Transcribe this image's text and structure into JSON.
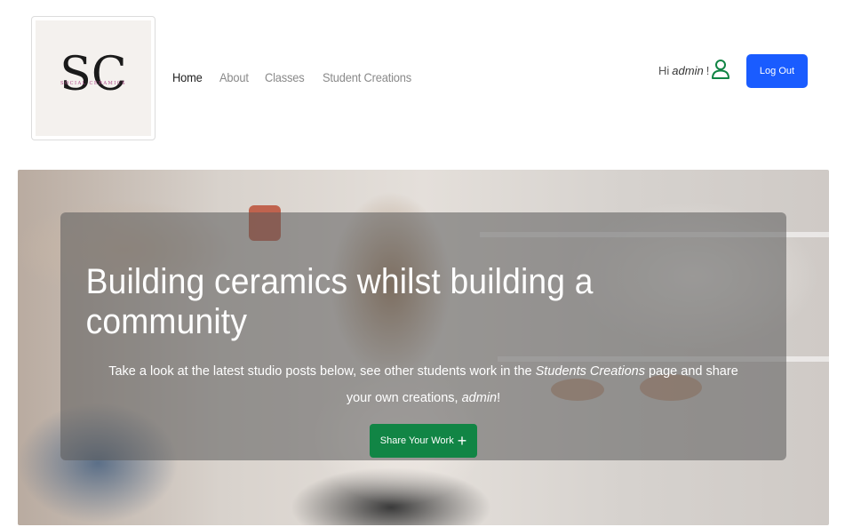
{
  "brand": {
    "logo_initials": "SC",
    "logo_text": "SOCIAL CERAMICS"
  },
  "nav": {
    "items": [
      {
        "label": "Home",
        "active": true
      },
      {
        "label": "About",
        "active": false
      },
      {
        "label": "Classes",
        "active": false
      },
      {
        "label": "Student Creations",
        "active": false
      }
    ]
  },
  "user": {
    "greeting_prefix": "Hi",
    "username": "admin",
    "greeting_suffix": "!",
    "icon": "user-icon",
    "logout_label": "Log Out"
  },
  "hero": {
    "title": "Building ceramics whilst building a community",
    "text_part1": "Take a look at the latest studio posts below, see other students work in the ",
    "text_emphasis": "Students Creations",
    "text_part2": " page and share your own creations, ",
    "text_username": "admin",
    "text_end": "!",
    "button_label": "Share Your Work",
    "button_icon": "plus-icon"
  },
  "colors": {
    "logout_button": "#1a5cff",
    "share_button": "#118545",
    "user_icon": "#118545",
    "nav_active": "#222222",
    "nav_inactive": "#8a8a8a"
  }
}
